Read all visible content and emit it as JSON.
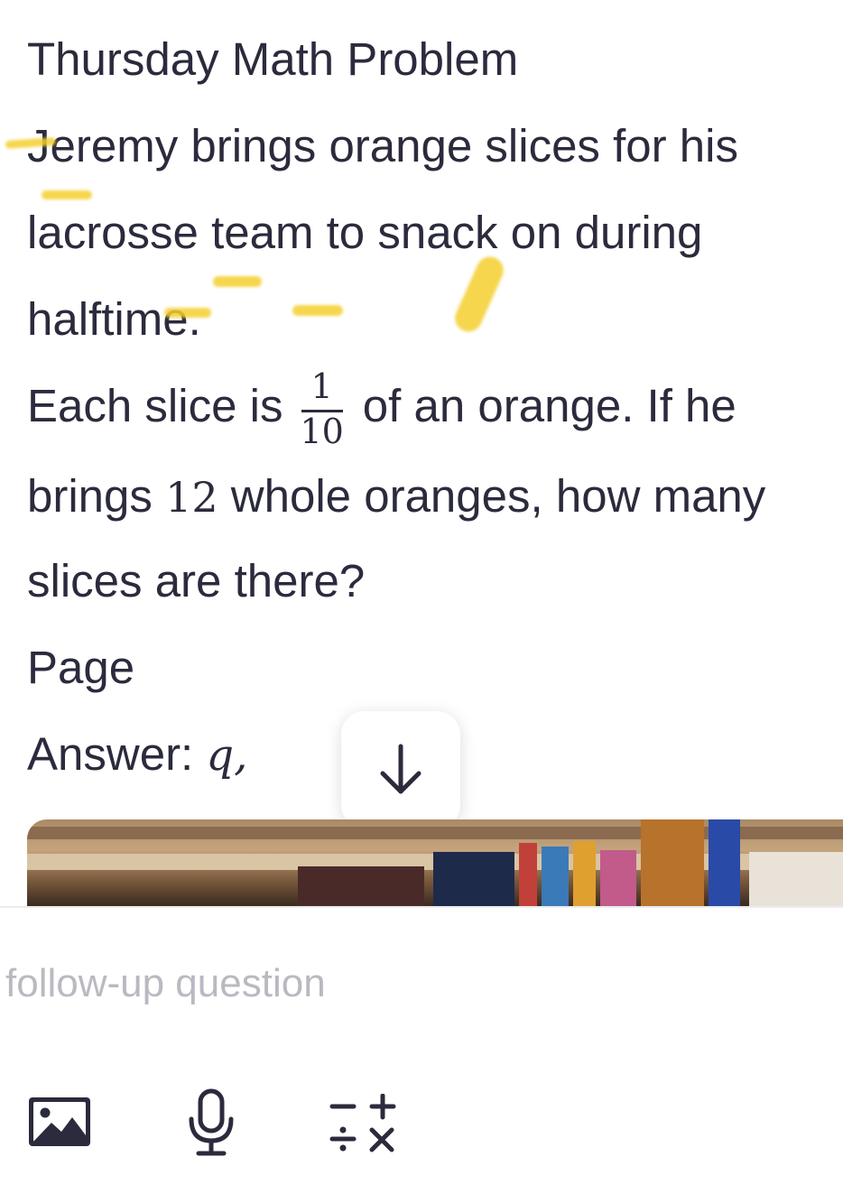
{
  "problem": {
    "title": "Thursday Math Problem",
    "line1": "Jeremy brings orange slices for his",
    "line2": "lacrosse team to snack on during",
    "line3": "halftime.",
    "line4_before": "Each slice is",
    "fraction": {
      "numerator": "1",
      "denominator": "10"
    },
    "line4_after": "of an orange. If he",
    "line5_before": "brings",
    "line5_number": "12",
    "line5_after": "whole oranges, how many",
    "line6": "slices are there?",
    "page_label": "Page",
    "answer_label": "Answer:",
    "answer_value": "q,"
  },
  "input": {
    "placeholder": "follow-up question"
  },
  "toolbar": {
    "icons": [
      "image-icon",
      "microphone-icon",
      "math-operators-icon"
    ]
  },
  "colors": {
    "text": "#2b2b3d",
    "placeholder": "#b9b9c2",
    "highlight": "#f5cf2f",
    "icon": "#2b2b3d"
  }
}
